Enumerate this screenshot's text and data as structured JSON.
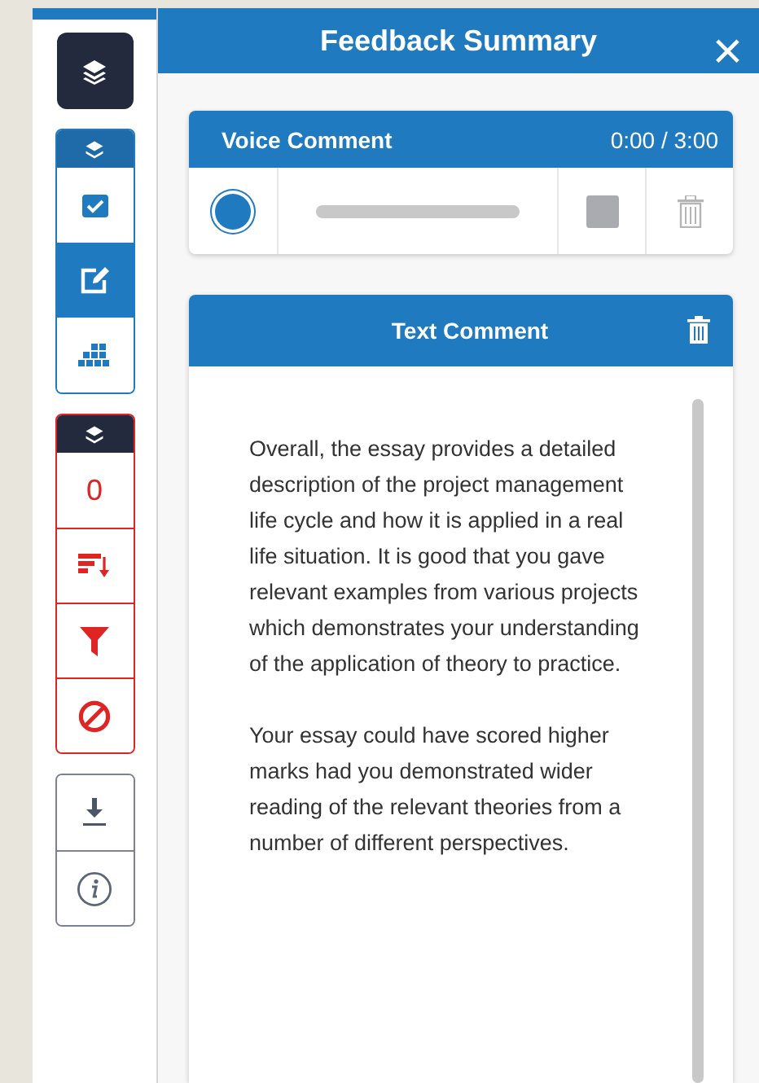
{
  "panel": {
    "title": "Feedback Summary",
    "close": "×"
  },
  "tool_groups": [
    {
      "kind": "single"
    },
    {
      "kind": "blue",
      "items": [
        {
          "selected": false
        },
        {
          "selected": true
        },
        {
          "selected": false
        }
      ]
    },
    {
      "kind": "red",
      "count": "0"
    },
    {
      "kind": "plain"
    }
  ],
  "voice_comment": {
    "title": "Voice Comment",
    "time": "0:00 / 3:00"
  },
  "text_comment": {
    "title": "Text Comment",
    "paragraphs": [
      "Overall, the essay provides a detailed description of the project management life cycle and how it is applied in a real life situation.  It is good that you gave relevant examples from various projects which demonstrates your understanding of the application of theory to practice.",
      "Your essay could have scored higher marks had you demonstrated wider reading of the relevant theories from a number of different perspectives."
    ]
  }
}
